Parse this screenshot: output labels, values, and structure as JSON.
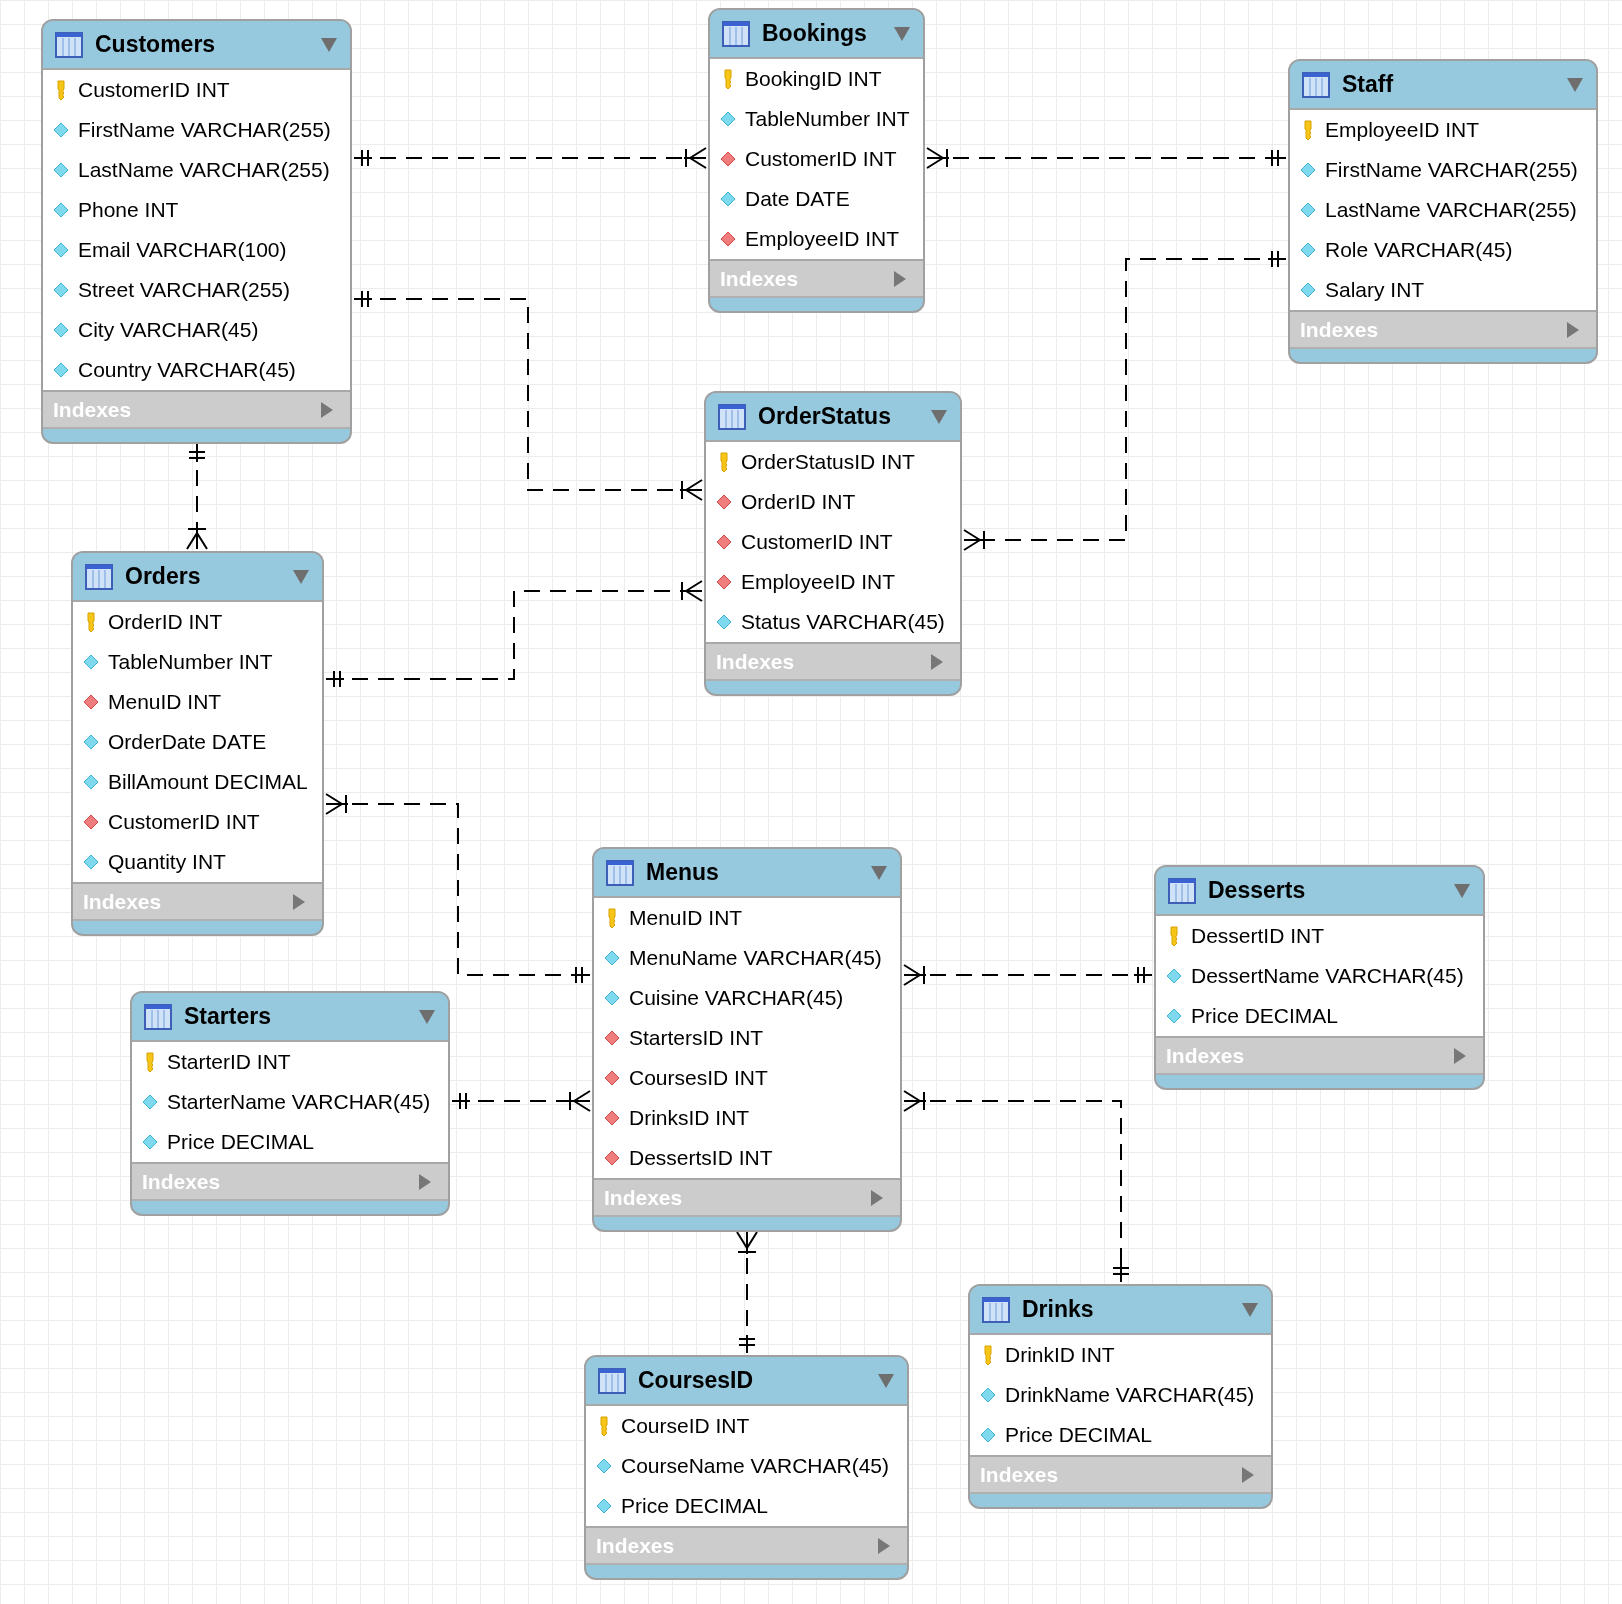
{
  "tables": [
    {
      "name": "Customers",
      "indexes_label": "Indexes",
      "columns": [
        {
          "name": "CustomerID INT",
          "kind": "pk"
        },
        {
          "name": "FirstName VARCHAR(255)",
          "kind": "attr"
        },
        {
          "name": "LastName VARCHAR(255)",
          "kind": "attr"
        },
        {
          "name": "Phone INT",
          "kind": "attr"
        },
        {
          "name": "Email VARCHAR(100)",
          "kind": "attr"
        },
        {
          "name": "Street VARCHAR(255)",
          "kind": "attr"
        },
        {
          "name": "City VARCHAR(45)",
          "kind": "attr"
        },
        {
          "name": "Country VARCHAR(45)",
          "kind": "attr"
        }
      ]
    },
    {
      "name": "Bookings",
      "indexes_label": "Indexes",
      "columns": [
        {
          "name": "BookingID INT",
          "kind": "pk"
        },
        {
          "name": "TableNumber INT",
          "kind": "attr"
        },
        {
          "name": "CustomerID INT",
          "kind": "fk"
        },
        {
          "name": "Date DATE",
          "kind": "attr"
        },
        {
          "name": "EmployeeID INT",
          "kind": "fk"
        }
      ]
    },
    {
      "name": "Staff",
      "indexes_label": "Indexes",
      "columns": [
        {
          "name": "EmployeeID INT",
          "kind": "pk"
        },
        {
          "name": "FirstName VARCHAR(255)",
          "kind": "attr"
        },
        {
          "name": "LastName VARCHAR(255)",
          "kind": "attr"
        },
        {
          "name": "Role VARCHAR(45)",
          "kind": "attr"
        },
        {
          "name": "Salary INT",
          "kind": "attr"
        }
      ]
    },
    {
      "name": "OrderStatus",
      "indexes_label": "Indexes",
      "columns": [
        {
          "name": "OrderStatusID INT",
          "kind": "pk"
        },
        {
          "name": "OrderID INT",
          "kind": "fk"
        },
        {
          "name": "CustomerID INT",
          "kind": "fk"
        },
        {
          "name": "EmployeeID INT",
          "kind": "fk"
        },
        {
          "name": "Status VARCHAR(45)",
          "kind": "attr"
        }
      ]
    },
    {
      "name": "Orders",
      "indexes_label": "Indexes",
      "columns": [
        {
          "name": "OrderID INT",
          "kind": "pk"
        },
        {
          "name": "TableNumber INT",
          "kind": "attr"
        },
        {
          "name": "MenuID INT",
          "kind": "fk"
        },
        {
          "name": "OrderDate DATE",
          "kind": "attr"
        },
        {
          "name": "BillAmount DECIMAL",
          "kind": "attr"
        },
        {
          "name": "CustomerID INT",
          "kind": "fk"
        },
        {
          "name": "Quantity INT",
          "kind": "attr"
        }
      ]
    },
    {
      "name": "Menus",
      "indexes_label": "Indexes",
      "columns": [
        {
          "name": "MenuID INT",
          "kind": "pk"
        },
        {
          "name": "MenuName VARCHAR(45)",
          "kind": "attr"
        },
        {
          "name": "Cuisine VARCHAR(45)",
          "kind": "attr"
        },
        {
          "name": "StartersID INT",
          "kind": "fk"
        },
        {
          "name": "CoursesID INT",
          "kind": "fk"
        },
        {
          "name": "DrinksID INT",
          "kind": "fk"
        },
        {
          "name": "DessertsID INT",
          "kind": "fk"
        }
      ]
    },
    {
      "name": "Desserts",
      "indexes_label": "Indexes",
      "columns": [
        {
          "name": "DessertID INT",
          "kind": "pk"
        },
        {
          "name": "DessertName VARCHAR(45)",
          "kind": "attr"
        },
        {
          "name": "Price DECIMAL",
          "kind": "attr"
        }
      ]
    },
    {
      "name": "Starters",
      "indexes_label": "Indexes",
      "columns": [
        {
          "name": "StarterID INT",
          "kind": "pk"
        },
        {
          "name": "StarterName VARCHAR(45)",
          "kind": "attr"
        },
        {
          "name": "Price DECIMAL",
          "kind": "attr"
        }
      ]
    },
    {
      "name": "Drinks",
      "indexes_label": "Indexes",
      "columns": [
        {
          "name": "DrinkID INT",
          "kind": "pk"
        },
        {
          "name": "DrinkName VARCHAR(45)",
          "kind": "attr"
        },
        {
          "name": "Price DECIMAL",
          "kind": "attr"
        }
      ]
    },
    {
      "name": "CoursesID",
      "indexes_label": "Indexes",
      "columns": [
        {
          "name": "CourseID INT",
          "kind": "pk"
        },
        {
          "name": "CourseName VARCHAR(45)",
          "kind": "attr"
        },
        {
          "name": "Price DECIMAL",
          "kind": "attr"
        }
      ]
    }
  ],
  "relationships": [
    {
      "ends": [
        {
          "kind": "one"
        },
        {
          "kind": "many"
        }
      ]
    },
    {
      "ends": [
        {
          "kind": "many"
        },
        {
          "kind": "one"
        }
      ]
    },
    {
      "ends": [
        {
          "kind": "one"
        },
        {
          "kind": "many"
        }
      ]
    },
    {
      "ends": [
        {
          "kind": "one"
        },
        {
          "kind": "many"
        }
      ]
    },
    {
      "ends": [
        {
          "kind": "one"
        },
        {
          "kind": "many"
        }
      ]
    },
    {
      "ends": [
        {
          "kind": "one"
        },
        {
          "kind": "many"
        }
      ]
    },
    {
      "ends": [
        {
          "kind": "many"
        },
        {
          "kind": "one"
        }
      ]
    },
    {
      "ends": [
        {
          "kind": "many"
        },
        {
          "kind": "one"
        }
      ]
    },
    {
      "ends": [
        {
          "kind": "one"
        },
        {
          "kind": "many"
        }
      ]
    },
    {
      "ends": [
        {
          "kind": "many"
        },
        {
          "kind": "one"
        }
      ]
    },
    {
      "ends": [
        {
          "kind": "many"
        },
        {
          "kind": "one"
        }
      ]
    }
  ]
}
